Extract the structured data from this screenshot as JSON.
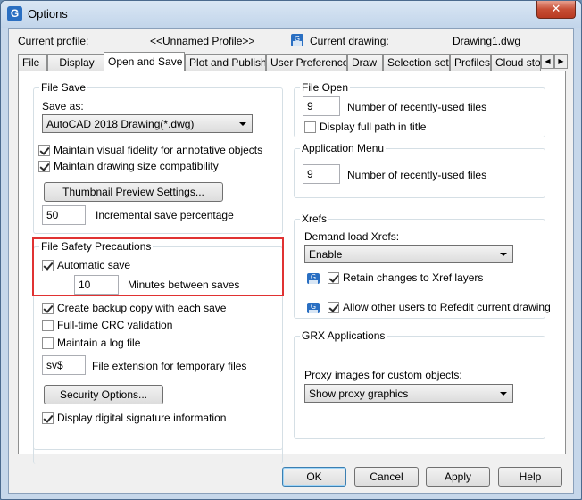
{
  "window": {
    "title": "Options",
    "close_glyph": "✕",
    "app_icon_glyph": "G"
  },
  "profile": {
    "current_profile_label": "Current profile:",
    "current_profile_value": "<<Unnamed Profile>>",
    "current_drawing_label": "Current drawing:",
    "current_drawing_value": "Drawing1.dwg"
  },
  "tabs": [
    "File",
    "Display",
    "Open and Save",
    "Plot and Publish",
    "User Preferences",
    "Draw",
    "Selection set",
    "Profiles",
    "Cloud stora"
  ],
  "tab_scroll": {
    "left": "◀",
    "right": "▶"
  },
  "file_save": {
    "title": "File Save",
    "save_as_label": "Save as:",
    "save_as_value": "AutoCAD 2018 Drawing(*.dwg)",
    "visual_fidelity": "Maintain visual fidelity for annotative objects",
    "size_compat": "Maintain drawing size compatibility",
    "thumbnail_btn": "Thumbnail Preview Settings...",
    "incremental_value": "50",
    "incremental_label": "Incremental save percentage"
  },
  "safety": {
    "title": "File Safety Precautions",
    "autosave": "Automatic save",
    "minutes_value": "10",
    "minutes_label": "Minutes between saves",
    "backup": "Create backup copy with each save",
    "crc": "Full-time CRC validation",
    "log": "Maintain a log file",
    "ext_value": "sv$",
    "ext_label": "File extension for temporary files",
    "security_btn": "Security Options...",
    "digital_sig": "Display digital signature information"
  },
  "file_open": {
    "title": "File Open",
    "recent_value": "9",
    "recent_label": "Number of recently-used files",
    "full_path": "Display full path in title"
  },
  "app_menu": {
    "title": "Application Menu",
    "recent_value": "9",
    "recent_label": "Number of recently-used files"
  },
  "xrefs": {
    "title": "Xrefs",
    "demand_label": "Demand load Xrefs:",
    "demand_value": "Enable",
    "retain": "Retain changes to Xref layers",
    "allow": "Allow other users to Refedit current drawing"
  },
  "grx": {
    "title": "GRX Applications",
    "proxy_label": "Proxy images for custom objects:",
    "proxy_value": "Show proxy graphics"
  },
  "footer": {
    "ok": "OK",
    "cancel": "Cancel",
    "apply": "Apply",
    "help": "Help"
  },
  "colors": {
    "highlight": "#e03232",
    "accent": "#2a6fc2"
  }
}
